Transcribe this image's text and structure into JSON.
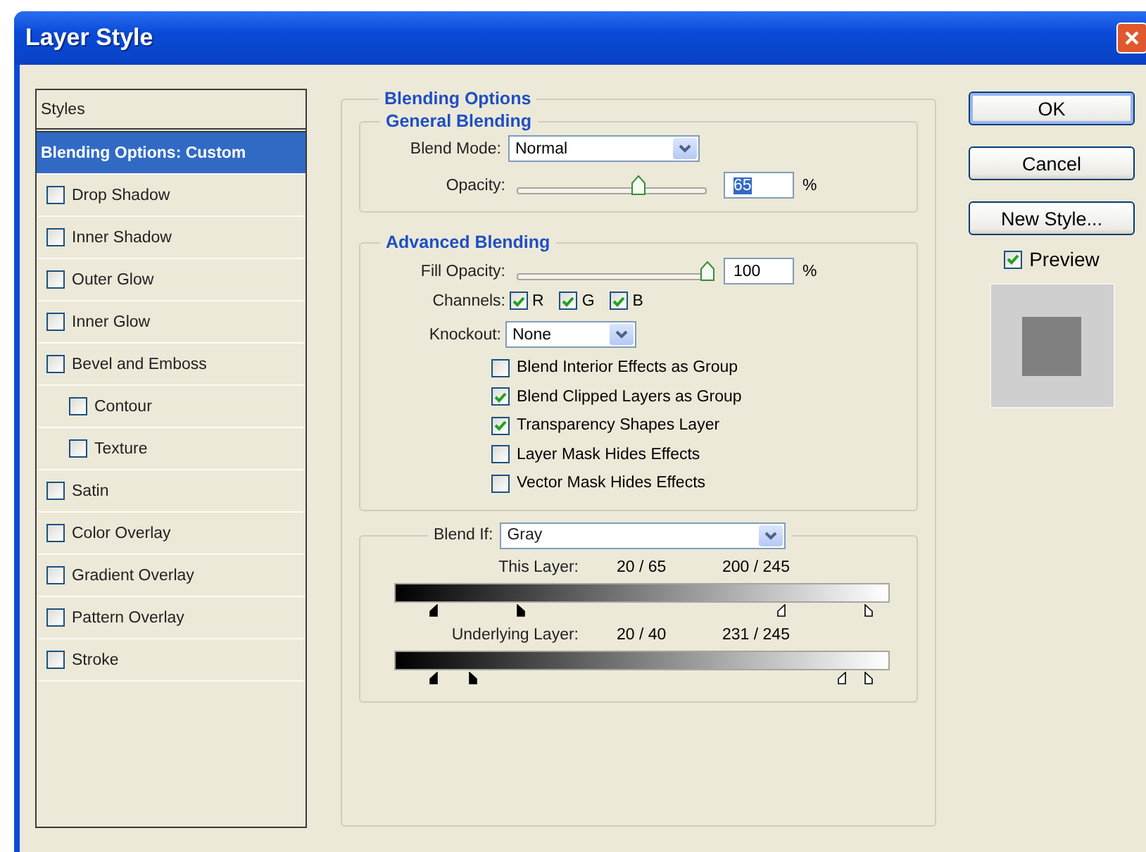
{
  "window": {
    "title": "Layer Style"
  },
  "styles_list": {
    "header": "Styles",
    "items": [
      {
        "label": "Blending Options: Custom",
        "kind": "heading",
        "selected": true
      },
      {
        "label": "Drop Shadow",
        "kind": "effect",
        "checked": false,
        "selected": false
      },
      {
        "label": "Inner Shadow",
        "kind": "effect",
        "checked": false,
        "selected": false
      },
      {
        "label": "Outer Glow",
        "kind": "effect",
        "checked": false,
        "selected": false
      },
      {
        "label": "Inner Glow",
        "kind": "effect",
        "checked": false,
        "selected": false
      },
      {
        "label": "Bevel and Emboss",
        "kind": "effect",
        "checked": false,
        "selected": false,
        "children": [
          {
            "label": "Contour",
            "kind": "effect",
            "checked": false,
            "selected": false
          },
          {
            "label": "Texture",
            "kind": "effect",
            "checked": false,
            "selected": false
          }
        ]
      },
      {
        "label": "Satin",
        "kind": "effect",
        "checked": false,
        "selected": false
      },
      {
        "label": "Color Overlay",
        "kind": "effect",
        "checked": false,
        "selected": false
      },
      {
        "label": "Gradient Overlay",
        "kind": "effect",
        "checked": false,
        "selected": false
      },
      {
        "label": "Pattern Overlay",
        "kind": "effect",
        "checked": false,
        "selected": false
      },
      {
        "label": "Stroke",
        "kind": "effect",
        "checked": false,
        "selected": false
      }
    ]
  },
  "blending_options": {
    "title": "Blending Options",
    "general": {
      "title": "General Blending",
      "blend_mode": {
        "label": "Blend Mode:",
        "value": "Normal"
      },
      "opacity": {
        "label": "Opacity:",
        "level": 0.64,
        "value": "65",
        "highlighted": true,
        "unit": "%"
      }
    },
    "advanced": {
      "title": "Advanced Blending",
      "fill_opacity": {
        "label": "Fill Opacity:",
        "level": 1,
        "value": "100",
        "highlighted": false,
        "unit": "%"
      },
      "channels": {
        "label": "Channels:",
        "items": [
          {
            "label": "R",
            "checked": true
          },
          {
            "label": "G",
            "checked": true
          },
          {
            "label": "B",
            "checked": true
          }
        ]
      },
      "knockout": {
        "label": "Knockout:",
        "value": "None"
      },
      "options": [
        {
          "label": "Blend Interior Effects as Group",
          "checked": false
        },
        {
          "label": "Blend Clipped Layers as Group",
          "checked": true
        },
        {
          "label": "Transparency Shapes Layer",
          "checked": true
        },
        {
          "label": "Layer Mask Hides Effects",
          "checked": false
        },
        {
          "label": "Vector Mask Hides Effects",
          "checked": false
        }
      ]
    },
    "blend_if": {
      "label": "Blend If:",
      "value": "Gray",
      "ranges": [
        {
          "label": "This Layer:",
          "low": "20 / 65",
          "high": "200 / 245",
          "handles": [
            {
              "kind": "black",
              "level": 0.078
            },
            {
              "kind": "black",
              "level": 0.255
            },
            {
              "kind": "white",
              "level": 0.784
            },
            {
              "kind": "white",
              "level": 0.961
            }
          ]
        },
        {
          "label": "Underlying Layer:",
          "low": "20 / 40",
          "high": "231 / 245",
          "handles": [
            {
              "kind": "black",
              "level": 0.078
            },
            {
              "kind": "black",
              "level": 0.157
            },
            {
              "kind": "white",
              "level": 0.906
            },
            {
              "kind": "white",
              "level": 0.961
            }
          ]
        }
      ]
    }
  },
  "buttons": [
    {
      "label": "OK",
      "default": true
    },
    {
      "label": "Cancel",
      "default": false
    },
    {
      "label": "New Style...",
      "default": false
    }
  ],
  "preview": {
    "label": "Preview",
    "checked": true
  }
}
